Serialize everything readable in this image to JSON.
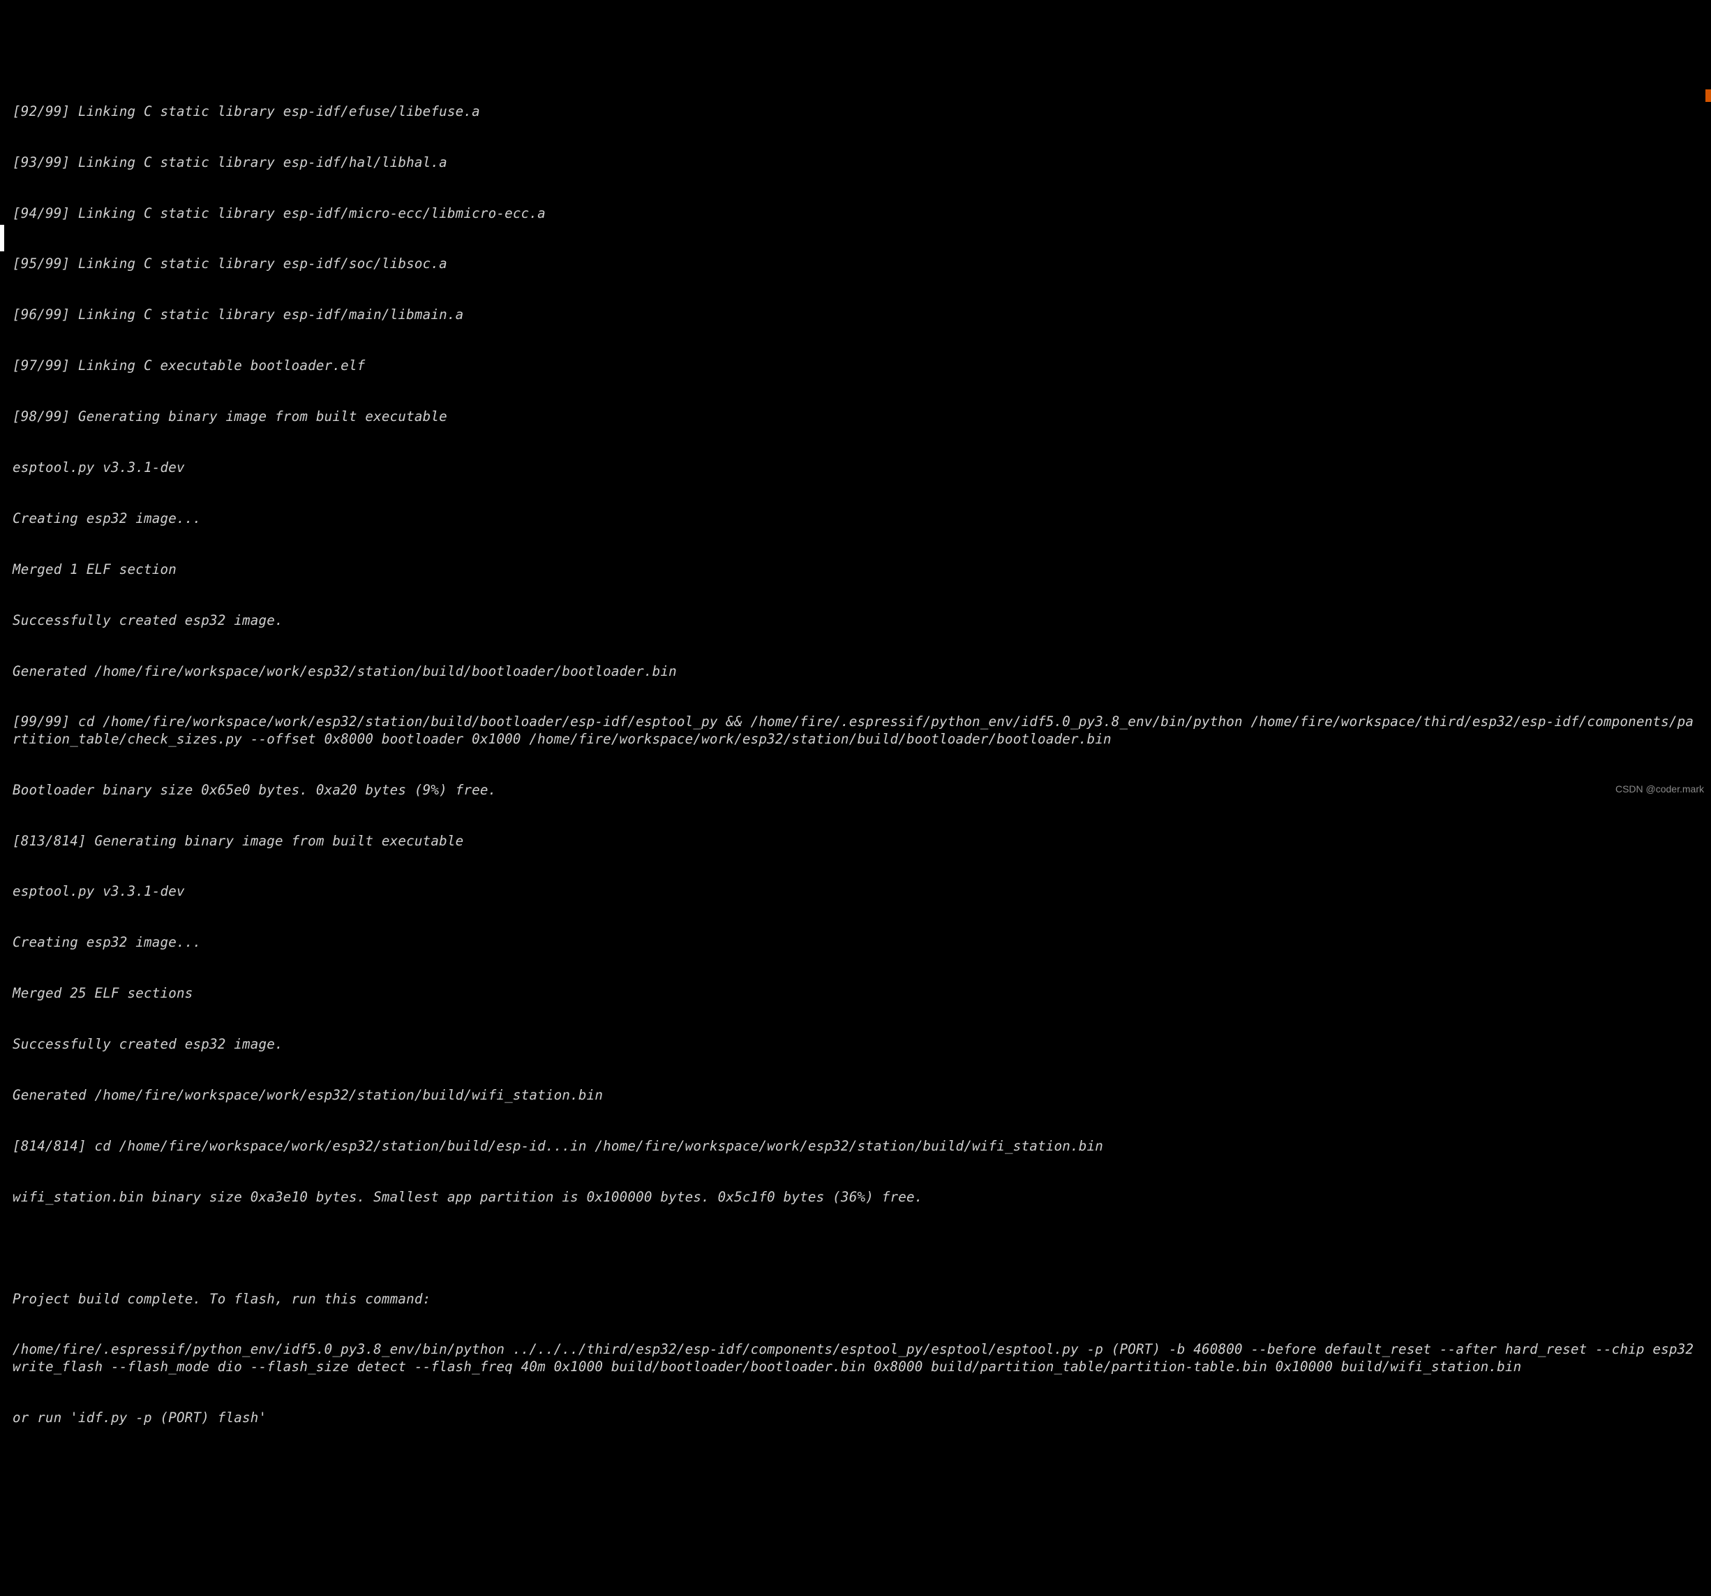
{
  "terminal": {
    "lines": [
      "[92/99] Linking C static library esp-idf/efuse/libefuse.a",
      "[93/99] Linking C static library esp-idf/hal/libhal.a",
      "[94/99] Linking C static library esp-idf/micro-ecc/libmicro-ecc.a",
      "[95/99] Linking C static library esp-idf/soc/libsoc.a",
      "[96/99] Linking C static library esp-idf/main/libmain.a",
      "[97/99] Linking C executable bootloader.elf",
      "[98/99] Generating binary image from built executable",
      "esptool.py v3.3.1-dev",
      "Creating esp32 image...",
      "Merged 1 ELF section",
      "Successfully created esp32 image.",
      "Generated /home/fire/workspace/work/esp32/station/build/bootloader/bootloader.bin",
      "[99/99] cd /home/fire/workspace/work/esp32/station/build/bootloader/esp-idf/esptool_py && /home/fire/.espressif/python_env/idf5.0_py3.8_env/bin/python /home/fire/workspace/third/esp32/esp-idf/components/partition_table/check_sizes.py --offset 0x8000 bootloader 0x1000 /home/fire/workspace/work/esp32/station/build/bootloader/bootloader.bin",
      "Bootloader binary size 0x65e0 bytes. 0xa20 bytes (9%) free.",
      "[813/814] Generating binary image from built executable",
      "esptool.py v3.3.1-dev",
      "Creating esp32 image...",
      "Merged 25 ELF sections",
      "Successfully created esp32 image.",
      "Generated /home/fire/workspace/work/esp32/station/build/wifi_station.bin",
      "[814/814] cd /home/fire/workspace/work/esp32/station/build/esp-id...in /home/fire/workspace/work/esp32/station/build/wifi_station.bin",
      "wifi_station.bin binary size 0xa3e10 bytes. Smallest app partition is 0x100000 bytes. 0x5c1f0 bytes (36%) free.",
      "",
      "Project build complete. To flash, run this command:",
      "/home/fire/.espressif/python_env/idf5.0_py3.8_env/bin/python ../../../third/esp32/esp-idf/components/esptool_py/esptool/esptool.py -p (PORT) -b 460800 --before default_reset --after hard_reset --chip esp32  write_flash --flash_mode dio --flash_size detect --flash_freq 40m 0x1000 build/bootloader/bootloader.bin 0x8000 build/partition_table/partition-table.bin 0x10000 build/wifi_station.bin",
      "or run 'idf.py -p (PORT) flash'"
    ]
  },
  "watermark": "CSDN @coder.mark"
}
